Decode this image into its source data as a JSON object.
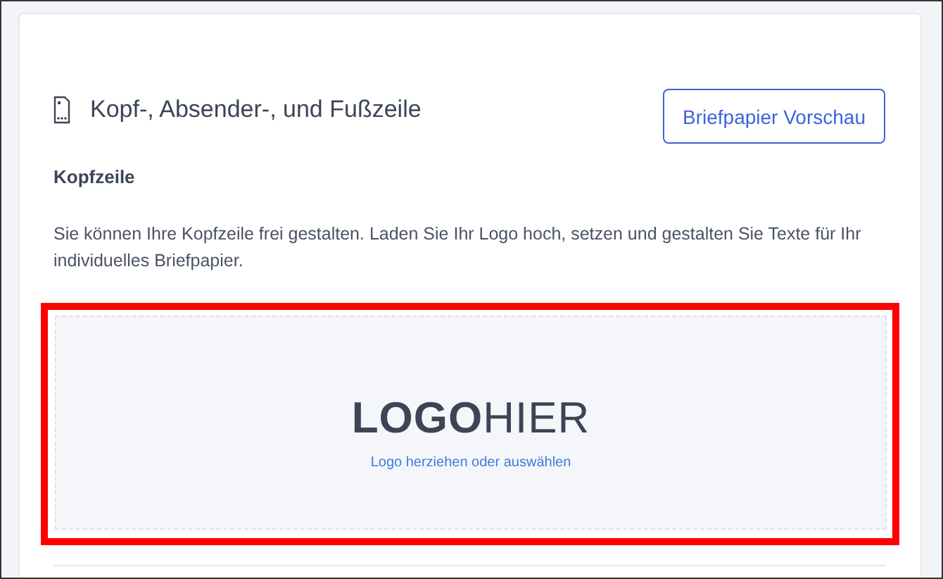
{
  "section": {
    "title": "Kopf-, Absender-, und Fußzeile",
    "preview_button": "Briefpapier Vorschau"
  },
  "header": {
    "heading": "Kopfzeile",
    "description": "Sie können Ihre Kopfzeile frei gestalten. Laden Sie Ihr Logo hoch, setzen und gestalten Sie Texte für Ihr individuelles Briefpapier."
  },
  "dropzone": {
    "logo": "**LOGO**HIER",
    "hint": "Logo herziehen oder auswählen",
    "highlighted": true
  }
}
